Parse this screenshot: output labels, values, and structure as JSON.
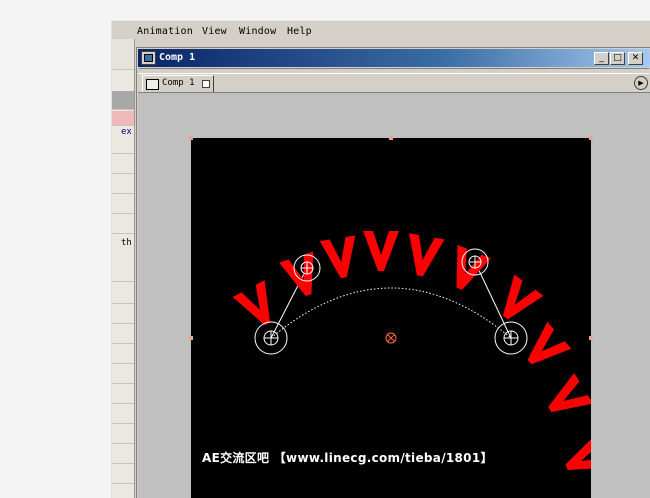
{
  "menu": {
    "items": [
      "Animation",
      "View",
      "Window",
      "Help"
    ]
  },
  "left_panel": {
    "snippets": [
      "ex",
      "th"
    ]
  },
  "comp_window": {
    "title": "Comp 1",
    "controls": {
      "minimize": "_",
      "maximize": "□",
      "close": "✕"
    },
    "tab": {
      "label": "Comp 1"
    }
  },
  "composition": {
    "background_color": "#000000",
    "text_color": "#ff0000",
    "path_text": "VVVVVVVVVV"
  },
  "watermark": "AE交流区吧 【www.linecg.com/tieba/1801】"
}
